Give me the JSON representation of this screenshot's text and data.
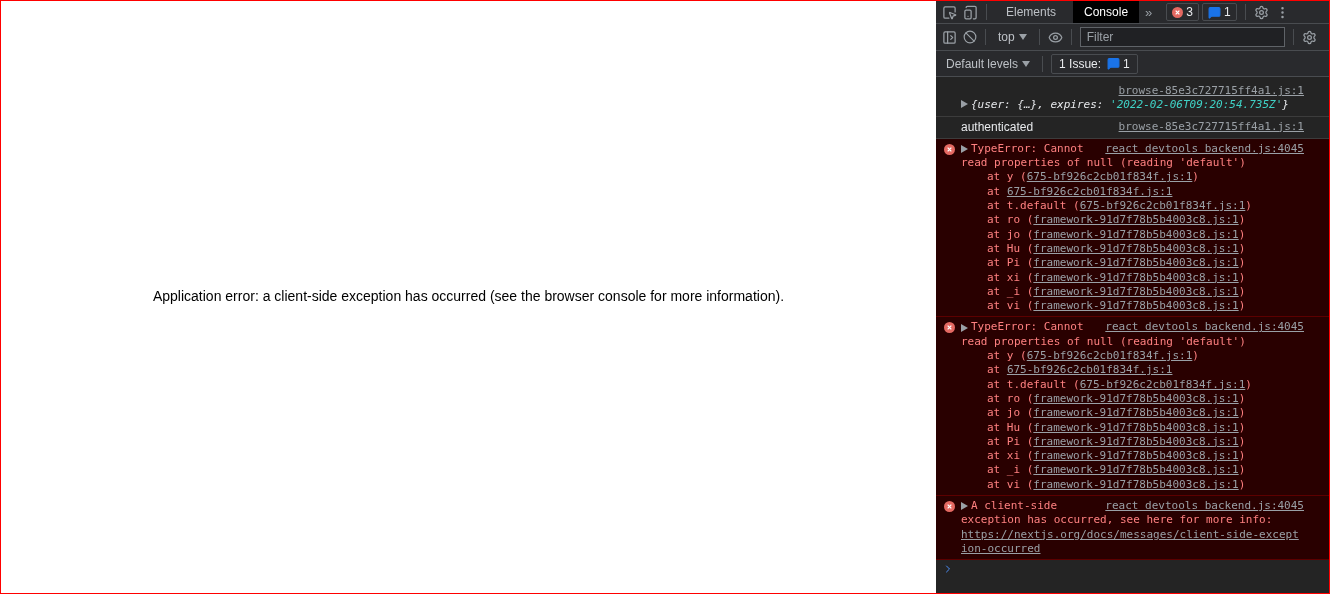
{
  "page": {
    "message": "Application error: a client-side exception has occurred (see the browser console for more information)."
  },
  "devtools": {
    "toolbar": {
      "tabs": [
        {
          "label": "Elements",
          "selected": false
        },
        {
          "label": "Console",
          "selected": true
        }
      ],
      "overflow": "»",
      "error_count": "3",
      "issue_count": "1"
    },
    "console_toolbar": {
      "context": "top",
      "filter": {
        "placeholder": "Filter"
      },
      "levels": "Default levels",
      "issues_label": "1 Issue:",
      "issues_count": "1"
    },
    "messages": [
      {
        "kind": "object",
        "source": "browse-85e3c727715ff4a1.js:1",
        "expanded": false,
        "preview": "{user: {…}, expires: ",
        "value": "'2022-02-06T09:20:54.735Z'",
        "preview_end": "}"
      },
      {
        "kind": "log",
        "text": "authenticated",
        "source": "browse-85e3c727715ff4a1.js:1"
      },
      {
        "kind": "error",
        "expanded": false,
        "lines": [
          "TypeError: Cannot",
          "read properties of null (reading 'default')"
        ],
        "source": "react devtools backend.js:4045",
        "frames": [
          {
            "text": "at y (",
            "file": "675-bf926c2cb01f834f.js:1",
            "end": ")"
          },
          {
            "text": "at ",
            "file": "675-bf926c2cb01f834f.js:1"
          },
          {
            "text": "at t.default (",
            "file": "675-bf926c2cb01f834f.js:1",
            "end": ")"
          },
          {
            "text": "at ro (",
            "file": "framework-91d7f78b5b4003c8.js:1",
            "end": ")"
          },
          {
            "text": "at jo (",
            "file": "framework-91d7f78b5b4003c8.js:1",
            "end": ")"
          },
          {
            "text": "at Hu (",
            "file": "framework-91d7f78b5b4003c8.js:1",
            "end": ")"
          },
          {
            "text": "at Pi (",
            "file": "framework-91d7f78b5b4003c8.js:1",
            "end": ")"
          },
          {
            "text": "at xi (",
            "file": "framework-91d7f78b5b4003c8.js:1",
            "end": ")"
          },
          {
            "text": "at _i (",
            "file": "framework-91d7f78b5b4003c8.js:1",
            "end": ")"
          },
          {
            "text": "at vi (",
            "file": "framework-91d7f78b5b4003c8.js:1",
            "end": ")"
          }
        ]
      },
      {
        "kind": "error",
        "expanded": false,
        "lines": [
          "TypeError: Cannot",
          "read properties of null (reading 'default')"
        ],
        "source": "react devtools backend.js:4045",
        "frames": [
          {
            "text": "at y (",
            "file": "675-bf926c2cb01f834f.js:1",
            "end": ")"
          },
          {
            "text": "at ",
            "file": "675-bf926c2cb01f834f.js:1"
          },
          {
            "text": "at t.default (",
            "file": "675-bf926c2cb01f834f.js:1",
            "end": ")"
          },
          {
            "text": "at ro (",
            "file": "framework-91d7f78b5b4003c8.js:1",
            "end": ")"
          },
          {
            "text": "at jo (",
            "file": "framework-91d7f78b5b4003c8.js:1",
            "end": ")"
          },
          {
            "text": "at Hu (",
            "file": "framework-91d7f78b5b4003c8.js:1",
            "end": ")"
          },
          {
            "text": "at Pi (",
            "file": "framework-91d7f78b5b4003c8.js:1",
            "end": ")"
          },
          {
            "text": "at xi (",
            "file": "framework-91d7f78b5b4003c8.js:1",
            "end": ")"
          },
          {
            "text": "at _i (",
            "file": "framework-91d7f78b5b4003c8.js:1",
            "end": ")"
          },
          {
            "text": "at vi (",
            "file": "framework-91d7f78b5b4003c8.js:1",
            "end": ")"
          }
        ]
      },
      {
        "kind": "error",
        "expanded": false,
        "lines": [
          "A client-side",
          "exception has occurred, see here for more info:"
        ],
        "link": "https://nextjs.org/docs/messages/client-side-exception-occurred",
        "source": "react devtools backend.js:4045"
      }
    ]
  }
}
